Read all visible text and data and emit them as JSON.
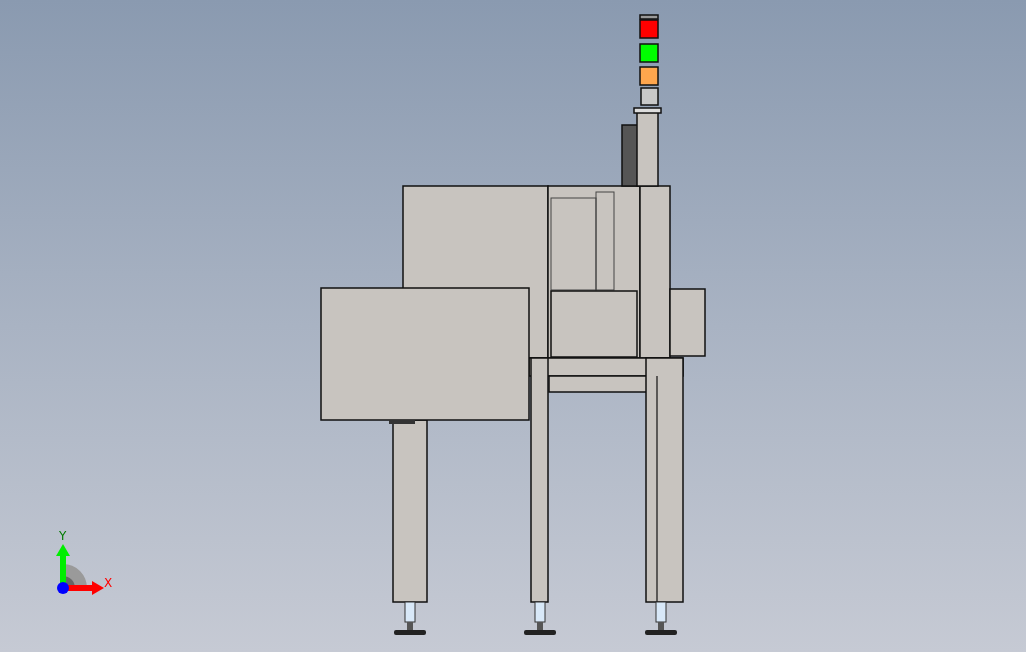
{
  "viewport": {
    "triad": {
      "y_label": "Y",
      "x_label": "X"
    }
  },
  "signal_tower": {
    "lamps": [
      {
        "color": "#ff0000"
      },
      {
        "color": "#00ff00"
      },
      {
        "color": "#ffa64d"
      }
    ]
  }
}
